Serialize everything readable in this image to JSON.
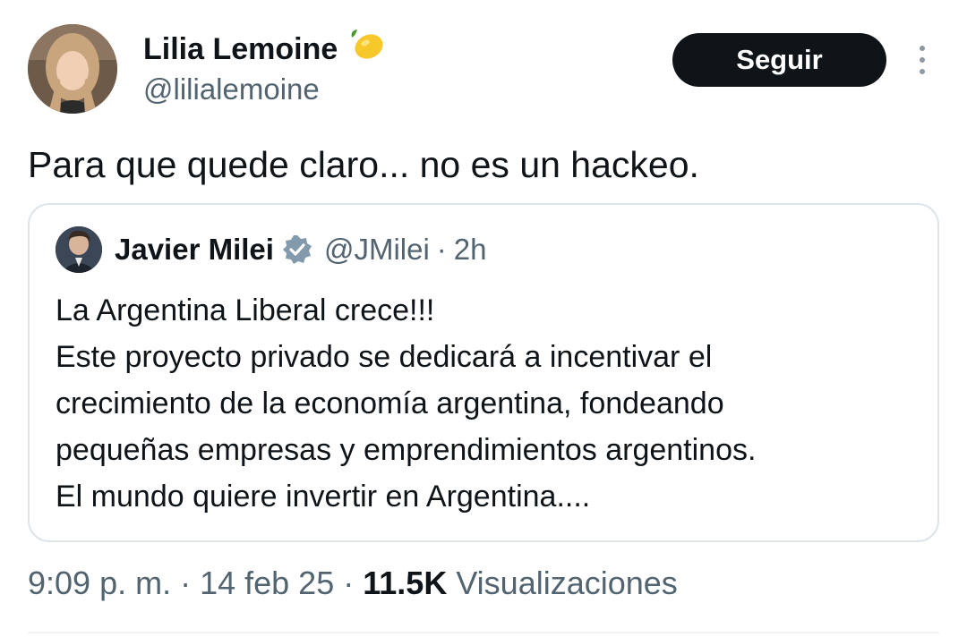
{
  "author": {
    "name": "Lilia Lemoine",
    "handle": "@lilialemoine",
    "badge_icon": "lemon-icon"
  },
  "follow_button": {
    "label": "Seguir"
  },
  "more_button": {
    "icon": "more-vertical-icon"
  },
  "tweet": {
    "text": "Para que quede claro... no es un hackeo."
  },
  "quoted": {
    "name": "Javier Milei",
    "verified_icon": "verified-badge-icon",
    "handle": "@JMilei",
    "separator": "·",
    "time": "2h",
    "lines": [
      "La Argentina Liberal crece!!!",
      "Este proyecto privado se dedicará a incentivar el",
      "crecimiento de la economía argentina, fondeando",
      "pequeñas empresas y emprendimientos argentinos.",
      "El mundo quiere invertir en Argentina...."
    ]
  },
  "meta": {
    "time": "9:09 p. m.",
    "sep1": " · ",
    "date": "14 feb 25",
    "sep2": " · ",
    "views_count": "11.5K",
    "views_label": " Visualizaciones"
  },
  "colors": {
    "text_primary": "#0f1419",
    "text_secondary": "#536471",
    "button_bg": "#0f1419",
    "border": "#dfe4e8",
    "verified": "#829aab"
  }
}
